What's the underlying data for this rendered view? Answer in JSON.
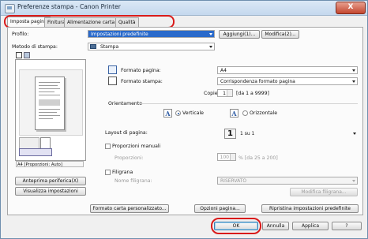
{
  "window": {
    "title": "Preferenze stampa - Canon Printer",
    "close_label": "X"
  },
  "tabs": [
    {
      "label": "Imposta pagina",
      "active": true
    },
    {
      "label": "Finitura"
    },
    {
      "label": "Alimentazione carta"
    },
    {
      "label": "Qualità"
    }
  ],
  "profile": {
    "label": "Profilo:",
    "value": "Impostazioni predefinite",
    "add_button": "Aggiungi(1)...",
    "edit_button": "Modifica(2)..."
  },
  "output_method": {
    "label": "Metodo di stampa:",
    "value": "Stampa"
  },
  "preview": {
    "caption": "A4 [Proporzioni: Auto]"
  },
  "page_size": {
    "label": "Formato pagina:",
    "value": "A4"
  },
  "output_size": {
    "label": "Formato stampa:",
    "value": "Corrispondenza formato pagina"
  },
  "copies": {
    "label": "Copie:",
    "value": "1",
    "range": "[da 1 a 9999]"
  },
  "orientation": {
    "label": "Orientamento",
    "portrait": "Verticale",
    "landscape": "Orizzontale",
    "icon_letter": "A"
  },
  "layout": {
    "label": "Layout di pagina:",
    "value": "1 su 1",
    "icon_number": "1"
  },
  "manual_scaling": {
    "label": "Proporzioni manuali",
    "scaling_label": "Proporzioni:",
    "value": "100",
    "range": "% [da 25 a 200]"
  },
  "watermark": {
    "label": "Filigrana",
    "name_label": "Nome filigrana:",
    "value": "RISERVATO",
    "edit_button": "Modifica filigrana..."
  },
  "left_buttons": {
    "peripheral_preview": "Anteprima periferica(X)",
    "view_settings": "Visualizza impostazioni"
  },
  "bottom_buttons": {
    "custom_paper": "Formato carta personalizzato...",
    "page_options": "Opzioni pagina...",
    "restore_defaults": "Ripristina impostazioni predefinite"
  },
  "dialog_buttons": {
    "ok": "OK",
    "cancel": "Annulla",
    "apply": "Applica",
    "help": "?"
  },
  "colors": {
    "highlight": "#2a6acb",
    "annotation_red": "#d91b1b"
  }
}
